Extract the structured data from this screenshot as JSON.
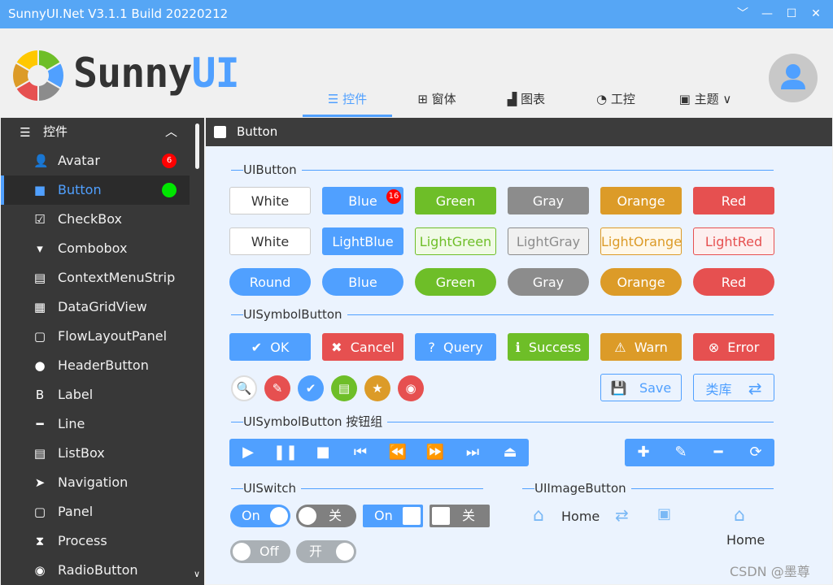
{
  "window": {
    "title": "SunnyUI.Net V3.1.1 Build 20220212",
    "controls": [
      "﹀",
      "—",
      "☐",
      "✕"
    ]
  },
  "logo": {
    "text_a": "Sunny",
    "text_b": "UI"
  },
  "nav": [
    {
      "label": "控件",
      "icon": "☰"
    },
    {
      "label": "窗体",
      "icon": "⊞"
    },
    {
      "label": "图表",
      "icon": "▟"
    },
    {
      "label": "工控",
      "icon": "◔"
    },
    {
      "label": "主题",
      "icon": "▣",
      "suffix": "∨"
    }
  ],
  "sidebar": {
    "header": "控件",
    "header_icon": "☰",
    "collapse": "︿",
    "items": [
      {
        "label": "Avatar",
        "icon": "👤",
        "badge": "6"
      },
      {
        "label": "Button",
        "icon": "■",
        "selected": true
      },
      {
        "label": "CheckBox",
        "icon": "☑"
      },
      {
        "label": "Combobox",
        "icon": "▾"
      },
      {
        "label": "ContextMenuStrip",
        "icon": "▤"
      },
      {
        "label": "DataGridView",
        "icon": "▦"
      },
      {
        "label": "FlowLayoutPanel",
        "icon": "▢"
      },
      {
        "label": "HeaderButton",
        "icon": "●"
      },
      {
        "label": "Label",
        "icon": "B"
      },
      {
        "label": "Line",
        "icon": "━"
      },
      {
        "label": "ListBox",
        "icon": "▤"
      },
      {
        "label": "Navigation",
        "icon": "➤"
      },
      {
        "label": "Panel",
        "icon": "▢"
      },
      {
        "label": "Process",
        "icon": "⧗"
      },
      {
        "label": "RadioButton",
        "icon": "◉"
      }
    ]
  },
  "page": {
    "title": "Button"
  },
  "groups": {
    "button": "UIButton",
    "symbol": "UISymbolButton",
    "symgroup": "UISymbolButton 按钮组",
    "switch": "UISwitch",
    "image": "UIImageButton"
  },
  "colors": {
    "blue": "#50a0ff",
    "green": "#6ebe28",
    "gray": "#8c8c8c",
    "orange": "#dc9b28",
    "red": "#e65050",
    "white": "#ffffff"
  },
  "buttons_row1": [
    {
      "label": "White",
      "style": "white"
    },
    {
      "label": "Blue",
      "style": "blue",
      "badge": "16"
    },
    {
      "label": "Green",
      "style": "green"
    },
    {
      "label": "Gray",
      "style": "gray"
    },
    {
      "label": "Orange",
      "style": "orange"
    },
    {
      "label": "Red",
      "style": "red"
    }
  ],
  "buttons_row2": [
    {
      "label": "White",
      "style": "white"
    },
    {
      "label": "LightBlue",
      "style": "blue"
    },
    {
      "label": "LightGreen",
      "style": "lgreen"
    },
    {
      "label": "LightGray",
      "style": "lgray"
    },
    {
      "label": "LightOrange",
      "style": "lorange"
    },
    {
      "label": "LightRed",
      "style": "lred"
    }
  ],
  "buttons_row3": [
    {
      "label": "Round",
      "style": "blue"
    },
    {
      "label": "Blue",
      "style": "blue"
    },
    {
      "label": "Green",
      "style": "green"
    },
    {
      "label": "Gray",
      "style": "gray"
    },
    {
      "label": "Orange",
      "style": "orange"
    },
    {
      "label": "Red",
      "style": "red"
    }
  ],
  "symbol_buttons": [
    {
      "label": "OK",
      "icon": "✔",
      "style": "blue"
    },
    {
      "label": "Cancel",
      "icon": "✖",
      "style": "red"
    },
    {
      "label": "Query",
      "icon": "?",
      "style": "blue"
    },
    {
      "label": "Success",
      "icon": "ℹ",
      "style": "green"
    },
    {
      "label": "Warn",
      "icon": "⚠",
      "style": "orange"
    },
    {
      "label": "Error",
      "icon": "⊗",
      "style": "red"
    }
  ],
  "circle_buttons": [
    {
      "icon": "search",
      "glyph": "🔍"
    },
    {
      "icon": "edit",
      "glyph": "✎"
    },
    {
      "icon": "check",
      "glyph": "✔"
    },
    {
      "icon": "id-card",
      "glyph": "▤"
    },
    {
      "icon": "star",
      "glyph": "★"
    },
    {
      "icon": "bucket",
      "glyph": "◉"
    }
  ],
  "save_button": {
    "label": "Save",
    "icon": "💾"
  },
  "library_button": {
    "label": "类库",
    "icon": "⇄"
  },
  "media_group": [
    {
      "name": "play",
      "glyph": "▶"
    },
    {
      "name": "pause",
      "glyph": "❚❚"
    },
    {
      "name": "stop",
      "glyph": "■"
    },
    {
      "name": "skip-start",
      "glyph": "⏮"
    },
    {
      "name": "rewind",
      "glyph": "⏪"
    },
    {
      "name": "forward",
      "glyph": "⏩"
    },
    {
      "name": "skip-end",
      "glyph": "⏭"
    },
    {
      "name": "eject",
      "glyph": "⏏"
    }
  ],
  "edit_group": [
    {
      "name": "plus",
      "glyph": "✚"
    },
    {
      "name": "edit",
      "glyph": "✎"
    },
    {
      "name": "minus",
      "glyph": "━"
    },
    {
      "name": "refresh",
      "glyph": "⟳"
    }
  ],
  "switches": {
    "s1": "On",
    "s2": "关",
    "s3": "On",
    "s4": "关",
    "s5": "Off",
    "s6": "开"
  },
  "image_buttons": {
    "home1": "Home",
    "home2": "Home"
  },
  "watermark": "CSDN @墨尊"
}
